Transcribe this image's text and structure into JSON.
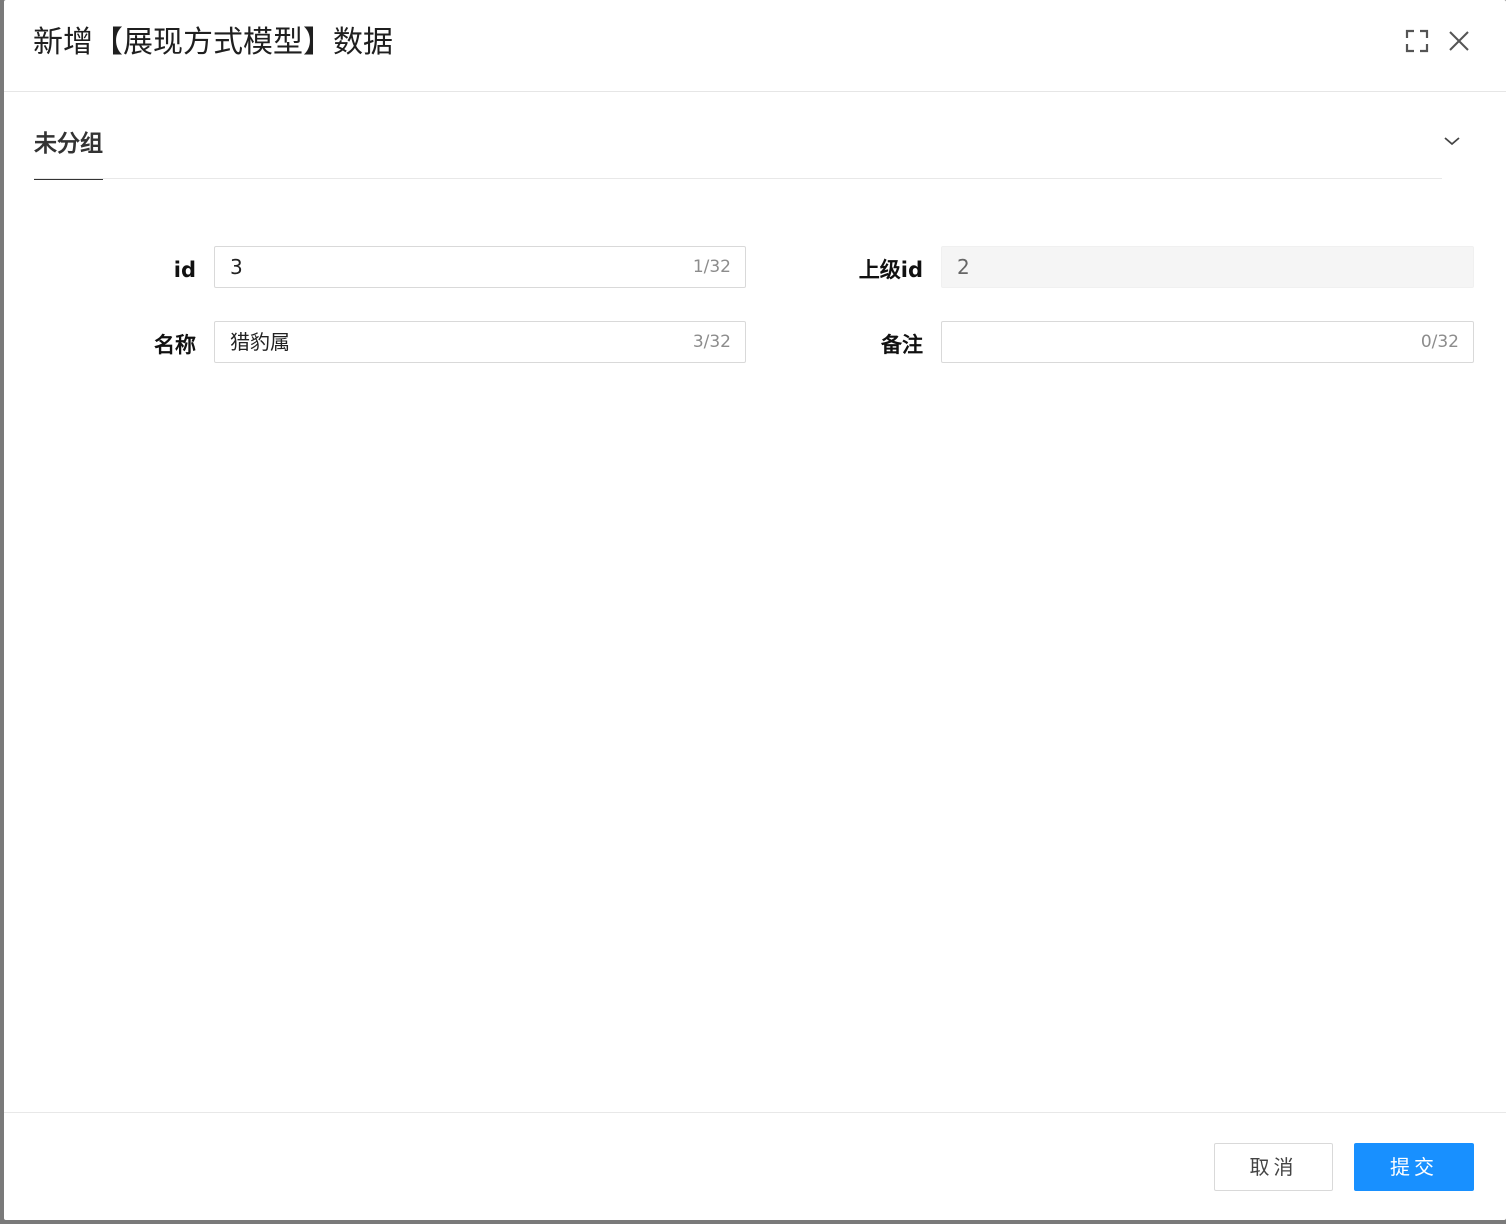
{
  "dialog": {
    "title": "新增【展现方式模型】数据",
    "icons": {
      "fullscreen": "fullscreen-icon",
      "close": "close-icon"
    }
  },
  "group": {
    "label": "未分组",
    "collapse_icon": "chevron-down-icon"
  },
  "form": {
    "fields": [
      {
        "label": "id",
        "value": "3",
        "counter": "1/32",
        "disabled": false
      },
      {
        "label": "上级id",
        "value": "2",
        "counter": "",
        "disabled": true
      },
      {
        "label": "名称",
        "value": "猎豹属",
        "counter": "3/32",
        "disabled": false
      },
      {
        "label": "备注",
        "value": "",
        "counter": "0/32",
        "disabled": false
      }
    ]
  },
  "footer": {
    "cancel_label": "取消",
    "submit_label": "提交"
  },
  "colors": {
    "primary": "#1890ff",
    "border": "#d9d9d9",
    "disabled_bg": "#f5f5f5"
  }
}
